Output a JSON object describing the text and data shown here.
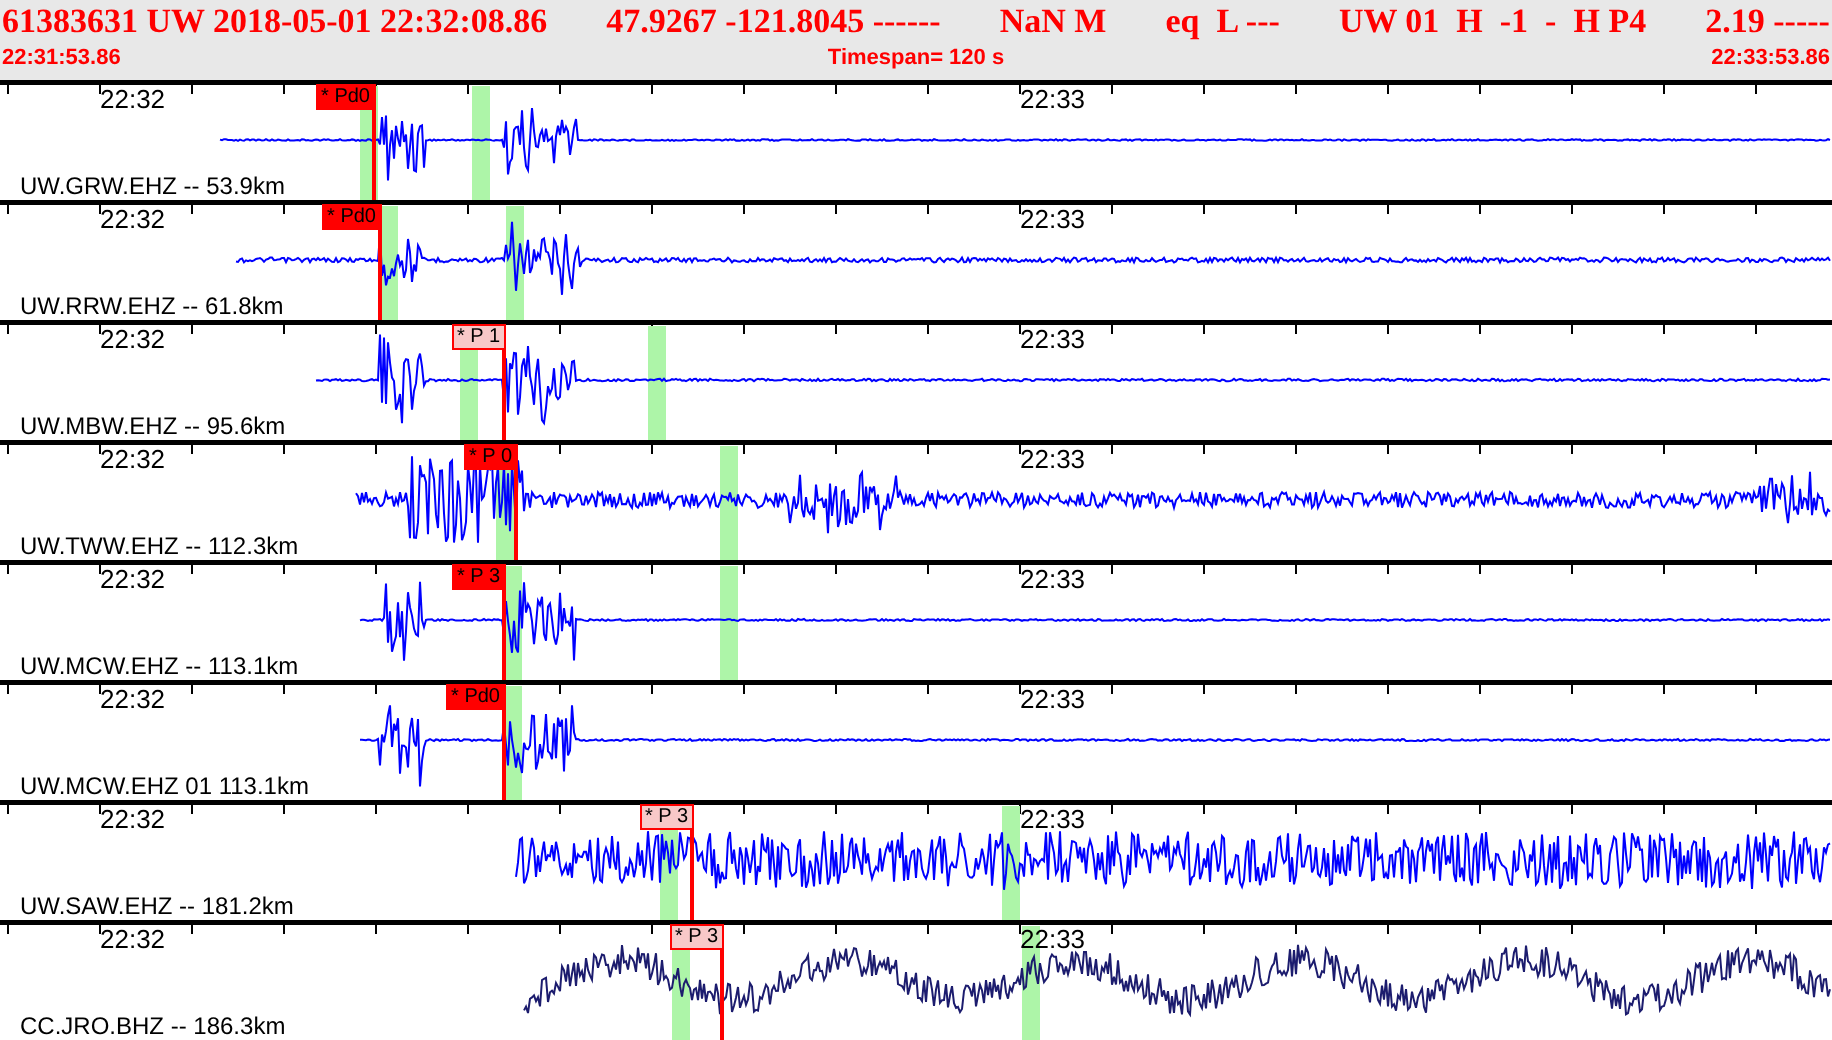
{
  "header": {
    "event_fields": [
      "61383631 UW 2018-05-01 22:32:08.86",
      "47.9267 -121.8045 ------",
      "NaN M",
      "eq  L ---",
      "UW 01  H  -1  -  H P4",
      "2.19 -----"
    ],
    "start_time": "22:31:53.86",
    "timespan": "Timespan= 120 s",
    "end_time": "22:33:53.86"
  },
  "traces": [
    {
      "channel": "UW.GRW.EHZ -- 53.9km",
      "time_labels": [
        "22:32",
        "22:33"
      ],
      "color": "#0000ff",
      "pick": {
        "label": "* Pd0",
        "kind": "solid"
      }
    },
    {
      "channel": "UW.RRW.EHZ -- 61.8km",
      "time_labels": [
        "22:32",
        "22:33"
      ],
      "color": "#0000ff",
      "pick": {
        "label": "* Pd0",
        "kind": "solid"
      }
    },
    {
      "channel": "UW.MBW.EHZ -- 95.6km",
      "time_labels": [
        "22:32",
        "22:33"
      ],
      "color": "#0000ff",
      "pick": {
        "label": "* P 1",
        "kind": "light"
      }
    },
    {
      "channel": "UW.TWW.EHZ -- 112.3km",
      "time_labels": [
        "22:32",
        "22:33"
      ],
      "color": "#0000ff",
      "pick": {
        "label": "* P 0",
        "kind": "solid"
      }
    },
    {
      "channel": "UW.MCW.EHZ -- 113.1km",
      "time_labels": [
        "22:32",
        "22:33"
      ],
      "color": "#0000ff",
      "pick": {
        "label": "* P 3",
        "kind": "solid"
      }
    },
    {
      "channel": "UW.MCW.EHZ 01 113.1km",
      "time_labels": [
        "22:32",
        "22:33"
      ],
      "color": "#0000ff",
      "pick": {
        "label": "* Pd0",
        "kind": "solid"
      }
    },
    {
      "channel": "UW.SAW.EHZ -- 181.2km",
      "time_labels": [
        "22:32",
        "22:33"
      ],
      "color": "#0000ff",
      "pick": {
        "label": "* P 3",
        "kind": "light"
      }
    },
    {
      "channel": "CC.JRO.BHZ -- 186.3km",
      "time_labels": [
        "22:32",
        "22:33"
      ],
      "color": "#1c1c6e",
      "pick": {
        "label": "* P 3",
        "kind": "light"
      }
    }
  ]
}
